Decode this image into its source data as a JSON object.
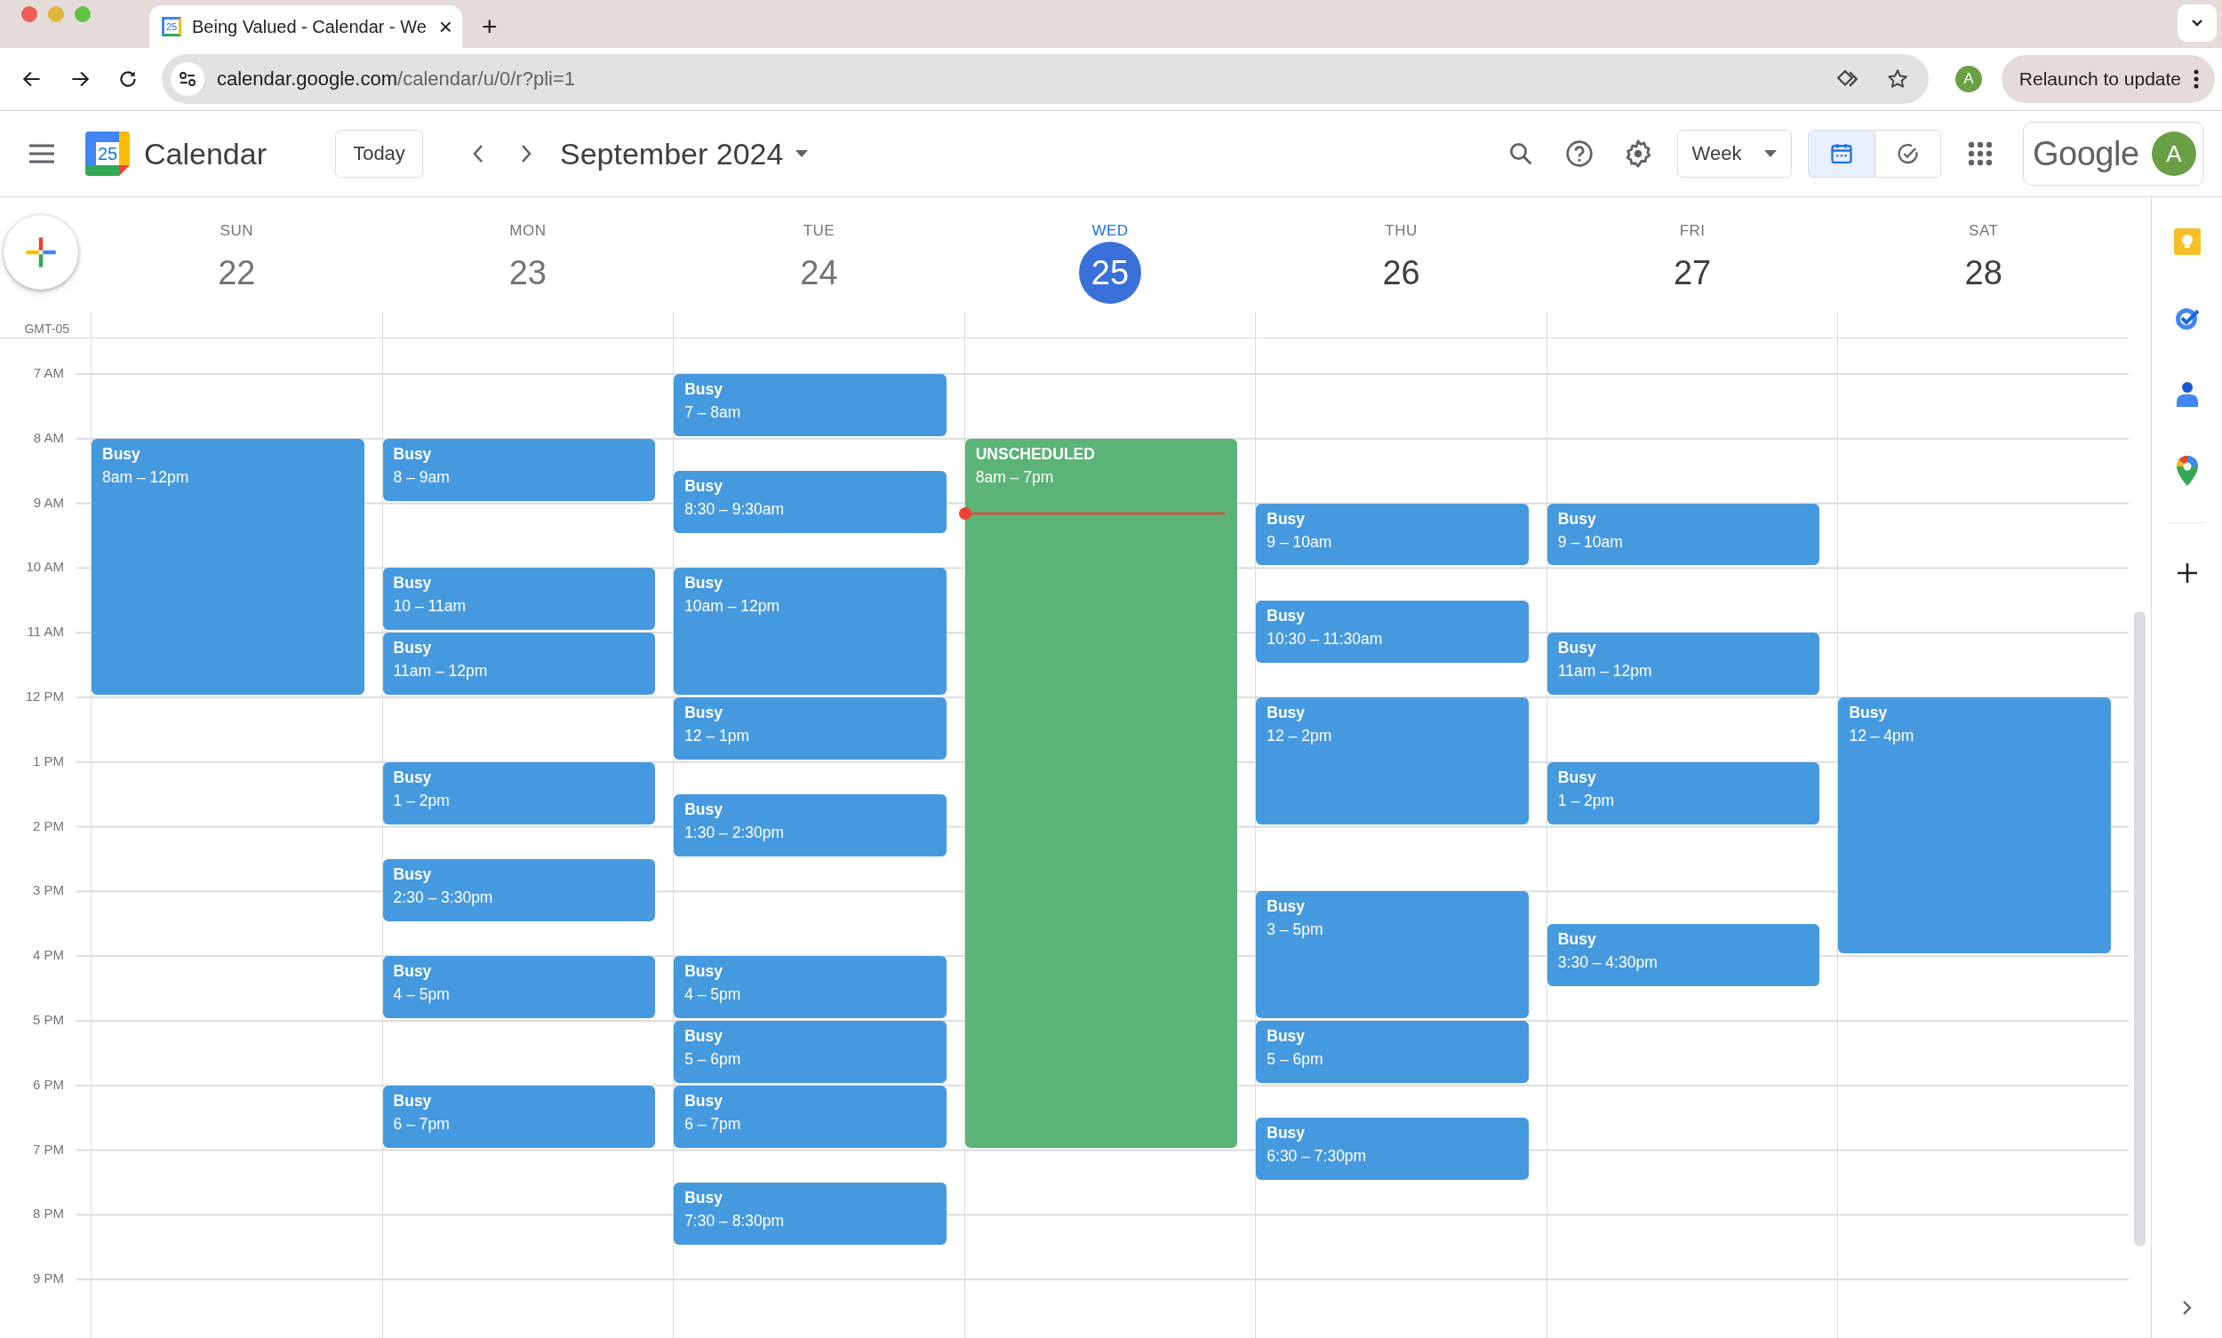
{
  "browser": {
    "tab": {
      "favicon_date": "25",
      "title": "Being Valued - Calendar - We",
      "close": "×"
    },
    "new_tab": "+",
    "url_host": "calendar.google.com",
    "url_path": "/calendar/u/0/r?pli=1",
    "profile": "A",
    "relaunch": "Relaunch to update"
  },
  "header": {
    "logo_date": "25",
    "app_name": "Calendar",
    "today_button": "Today",
    "period": "September 2024",
    "view_select": "Week",
    "view_toggle": [
      {
        "kind": "calendar",
        "selected": true
      },
      {
        "kind": "tasks",
        "selected": false
      }
    ],
    "brand": "Google",
    "avatar": "A"
  },
  "timezone": "GMT-05",
  "hours": [
    "7 AM",
    "8 AM",
    "9 AM",
    "10 AM",
    "11 AM",
    "12 PM",
    "1 PM",
    "2 PM",
    "3 PM",
    "4 PM",
    "5 PM",
    "6 PM",
    "7 PM",
    "8 PM",
    "9 PM"
  ],
  "days": [
    {
      "weekday": "SUN",
      "date": "22",
      "today": false,
      "events": [
        {
          "title": "Busy",
          "time": "8am – 12pm",
          "color": "#4599df"
        }
      ]
    },
    {
      "weekday": "MON",
      "date": "23",
      "today": false,
      "events": [
        {
          "title": "Busy",
          "time": "8 – 9am",
          "color": "#4599df"
        },
        {
          "title": "Busy",
          "time": "10 – 11am",
          "color": "#4599df"
        },
        {
          "title": "Busy",
          "time": "11am – 12pm",
          "color": "#4599df"
        },
        {
          "title": "Busy",
          "time": "1 – 2pm",
          "color": "#4599df"
        },
        {
          "title": "Busy",
          "time": "2:30 – 3:30pm",
          "color": "#4599df"
        },
        {
          "title": "Busy",
          "time": "4 – 5pm",
          "color": "#4599df"
        },
        {
          "title": "Busy",
          "time": "6 – 7pm",
          "color": "#4599df"
        }
      ]
    },
    {
      "weekday": "TUE",
      "date": "24",
      "today": false,
      "events": [
        {
          "title": "Busy",
          "time": "7 – 8am",
          "color": "#4599df"
        },
        {
          "title": "Busy",
          "time": "8:30 – 9:30am",
          "color": "#4599df"
        },
        {
          "title": "Busy",
          "time": "10am – 12pm",
          "color": "#4599df"
        },
        {
          "title": "Busy",
          "time": "12 – 1pm",
          "color": "#4599df"
        },
        {
          "title": "Busy",
          "time": "1:30 – 2:30pm",
          "color": "#4599df"
        },
        {
          "title": "Busy",
          "time": "4 – 5pm",
          "color": "#4599df"
        },
        {
          "title": "Busy",
          "time": "5 – 6pm",
          "color": "#4599df"
        },
        {
          "title": "Busy",
          "time": "6 – 7pm",
          "color": "#4599df"
        },
        {
          "title": "Busy",
          "time": "7:30 – 8:30pm",
          "color": "#4599df"
        }
      ]
    },
    {
      "weekday": "WED",
      "date": "25",
      "today": true,
      "events": [
        {
          "title": "UNSCHEDULED",
          "time": "8am – 7pm",
          "color": "#5bb377"
        }
      ]
    },
    {
      "weekday": "THU",
      "date": "26",
      "today": false,
      "events": [
        {
          "title": "Busy",
          "time": "9 – 10am",
          "color": "#4599df"
        },
        {
          "title": "Busy",
          "time": "10:30 – 11:30am",
          "color": "#4599df"
        },
        {
          "title": "Busy",
          "time": "12 – 2pm",
          "color": "#4599df"
        },
        {
          "title": "Busy",
          "time": "3 – 5pm",
          "color": "#4599df"
        },
        {
          "title": "Busy",
          "time": "5 – 6pm",
          "color": "#4599df"
        },
        {
          "title": "Busy",
          "time": "6:30 – 7:30pm",
          "color": "#4599df"
        }
      ]
    },
    {
      "weekday": "FRI",
      "date": "27",
      "today": false,
      "events": [
        {
          "title": "Busy",
          "time": "9 – 10am",
          "color": "#4599df"
        },
        {
          "title": "Busy",
          "time": "11am – 12pm",
          "color": "#4599df"
        },
        {
          "title": "Busy",
          "time": "1 – 2pm",
          "color": "#4599df"
        },
        {
          "title": "Busy",
          "time": "3:30 – 4:30pm",
          "color": "#4599df"
        }
      ]
    },
    {
      "weekday": "SAT",
      "date": "28",
      "today": false,
      "events": [
        {
          "title": "Busy",
          "time": "12 – 4pm",
          "color": "#4599df"
        }
      ]
    }
  ]
}
